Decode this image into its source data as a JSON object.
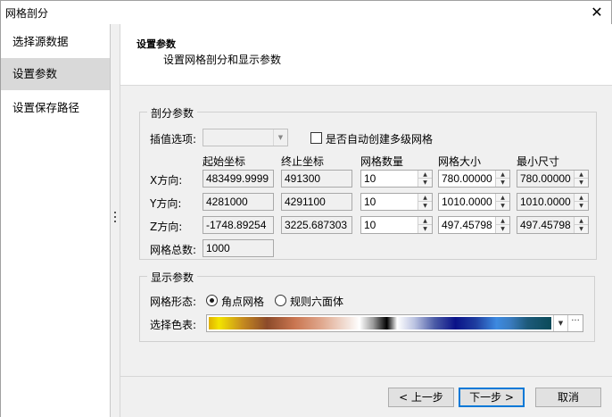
{
  "window": {
    "title": "网格剖分"
  },
  "sidebar": {
    "items": [
      {
        "label": "选择源数据",
        "active": false
      },
      {
        "label": "设置参数",
        "active": true
      },
      {
        "label": "设置保存路径",
        "active": false
      }
    ]
  },
  "header": {
    "title": "设置参数",
    "subtitle": "设置网格剖分和显示参数"
  },
  "split_params": {
    "legend": "剖分参数",
    "interp_label": "插值选项:",
    "interp_value": "",
    "auto_multilevel_label": "是否自动创建多级网格",
    "auto_multilevel_checked": false,
    "columns": {
      "start": "起始坐标",
      "end": "终止坐标",
      "count": "网格数量",
      "size": "网格大小",
      "min_size": "最小尺寸"
    },
    "rows": [
      {
        "label": "X方向:",
        "start": "483499.9999",
        "end": "491300",
        "count": "10",
        "size": "780.00000",
        "min_size": "780.00000"
      },
      {
        "label": "Y方向:",
        "start": "4281000",
        "end": "4291100",
        "count": "10",
        "size": "1010.0000",
        "min_size": "1010.0000"
      },
      {
        "label": "Z方向:",
        "start": "-1748.89254",
        "end": "3225.687303",
        "count": "10",
        "size": "497.45798",
        "min_size": "497.45798"
      }
    ],
    "total_label": "网格总数:",
    "total_value": "1000"
  },
  "display_params": {
    "legend": "显示参数",
    "shape_label": "网格形态:",
    "shape_options": [
      "角点网格",
      "规则六面体"
    ],
    "shape_selected": "角点网格",
    "colortable_label": "选择色表:"
  },
  "buttons": {
    "prev": "< 上一步",
    "next": "下一步 >",
    "cancel": "取消"
  }
}
